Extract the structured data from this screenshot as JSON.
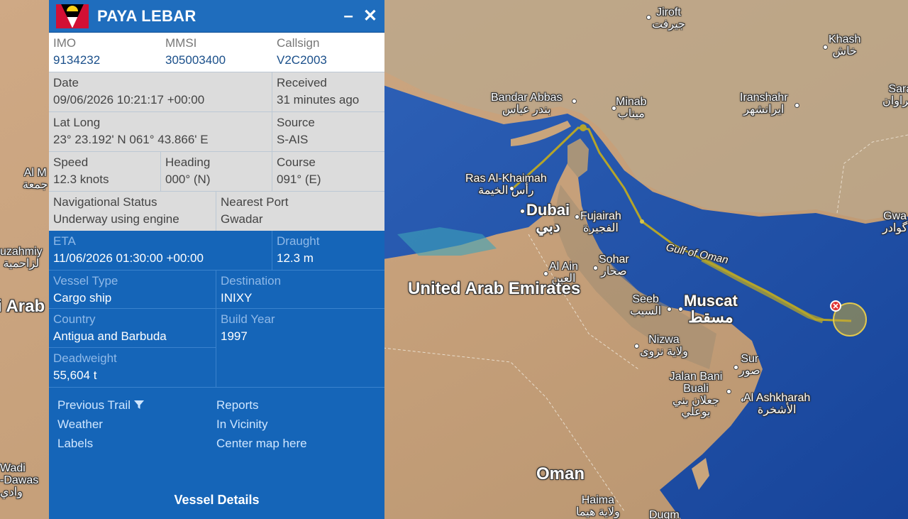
{
  "vessel": {
    "name": "PAYA LEBAR",
    "flag_icon": "antigua-and-barbuda-flag-icon",
    "minimize_symbol": "–",
    "close_symbol": "✕"
  },
  "details": {
    "imo_label": "IMO",
    "imo": "9134232",
    "mmsi_label": "MMSI",
    "mmsi": "305003400",
    "callsign_label": "Callsign",
    "callsign": "V2C2003",
    "date_label": "Date",
    "date": "09/06/2026 10:21:17 +00:00",
    "received_label": "Received",
    "received": "31 minutes ago",
    "latlong_label": "Lat Long",
    "latlong": "23° 23.192' N 061° 43.866' E",
    "source_label": "Source",
    "source": "S-AIS",
    "speed_label": "Speed",
    "speed": "12.3 knots",
    "heading_label": "Heading",
    "heading": "000° (N)",
    "course_label": "Course",
    "course": "091° (E)",
    "navstatus_label": "Navigational Status",
    "navstatus": "Underway using engine",
    "nearestport_label": "Nearest Port",
    "nearestport": "Gwadar",
    "eta_label": "ETA",
    "eta": "11/06/2026 01:30:00 +00:00",
    "draught_label": "Draught",
    "draught": "12.3 m",
    "vesseltype_label": "Vessel Type",
    "vesseltype": "Cargo ship",
    "destination_label": "Destination",
    "destination": "INIXY",
    "country_label": "Country",
    "country": "Antigua and Barbuda",
    "buildyear_label": "Build Year",
    "buildyear": "1997",
    "deadweight_label": "Deadweight",
    "deadweight": "55,604 t"
  },
  "links": {
    "previous_trail": "Previous Trail",
    "filter_icon": "filter-icon",
    "reports": "Reports",
    "weather": "Weather",
    "in_vicinity": "In Vicinity",
    "labels": "Labels",
    "center_map": "Center map here",
    "vessel_details": "Vessel Details"
  },
  "map": {
    "labels": {
      "jiroft": "Jiroft",
      "jiroft_ar": "جيرفت",
      "khash": "Khash",
      "khash_ar": "خاش",
      "bandar_abbas": "Bandar Abbas",
      "bandar_abbas_ar": "بندر عباس",
      "minab": "Minab",
      "minab_ar": "ميناب",
      "iranshahr": "Iranshahr",
      "iranshahr_ar": "ايرانشهر",
      "sara": "Sara",
      "sara_ar": "سراوان",
      "ras_al_khaimah": "Ras Al-Khaimah",
      "ras_al_khaimah_ar": "رأس الخيمة",
      "dubai": "Dubai",
      "dubai_ar": "دبي",
      "fujairah": "Fujairah",
      "fujairah_ar": "الفجيرة",
      "gwa": "Gwa",
      "gwa_ar": "گوادر",
      "sohar": "Sohar",
      "sohar_ar": "صحار",
      "al_ain": "Al Ain",
      "al_ain_ar": "العين",
      "gulf_of_oman": "Gulf of Oman",
      "uae": "United Arab Emirates",
      "seeb": "Seeb",
      "seeb_ar": "السيب",
      "muscat": "Muscat",
      "muscat_ar": "مسقط",
      "nizwa": "Nizwa",
      "nizwa_ar": "ولاية نزوى",
      "sur": "Sur",
      "sur_ar": "صور",
      "jalan": "Jalan Bani Buali",
      "jalan_ar": "جعلان بني بوعلي",
      "ashkharah": "Al Ashkharah",
      "ashkharah_ar": "الأشخرة",
      "oman": "Oman",
      "haima": "Haima",
      "haima_ar": "ولاية هيما",
      "duqm": "Duqm",
      "al_m": "Al M",
      "al_m_ar": "جمعة",
      "uzahmiy": "uzahmiy",
      "uzahmiy_ar": "لزاحمية",
      "arab": "i Arab",
      "wadi": "Wadi",
      "wadi2": "-Dawas",
      "wadi_ar": "وادي"
    },
    "colors": {
      "sea": "#1f4ea5",
      "land": "#c9a57c",
      "trail": "#b5a52a",
      "marker": "#e03434"
    }
  }
}
